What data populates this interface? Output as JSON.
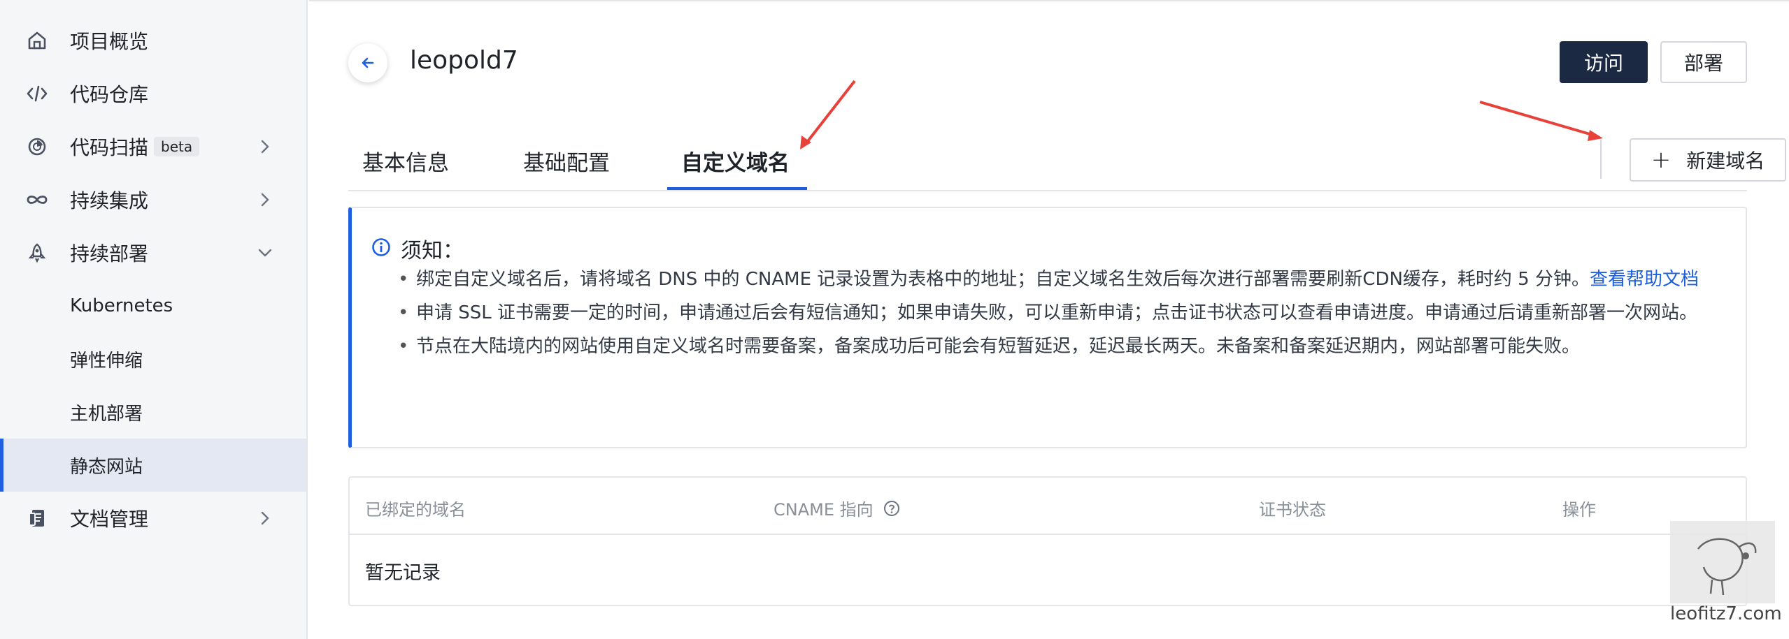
{
  "sidebar": {
    "items": [
      {
        "label": "项目概览",
        "icon": "home-icon"
      },
      {
        "label": "代码仓库",
        "icon": "code-icon"
      },
      {
        "label": "代码扫描",
        "icon": "scan-icon",
        "badge": "beta"
      },
      {
        "label": "持续集成",
        "icon": "infinity-icon"
      },
      {
        "label": "持续部署",
        "icon": "rocket-icon"
      },
      {
        "label": "Kubernetes"
      },
      {
        "label": "弹性伸缩"
      },
      {
        "label": "主机部署"
      },
      {
        "label": "静态网站",
        "active": true
      },
      {
        "label": "文档管理",
        "icon": "doc-icon"
      }
    ]
  },
  "header": {
    "title": "leopold7",
    "visit_label": "访问",
    "deploy_label": "部署"
  },
  "tabs": [
    {
      "label": "基本信息"
    },
    {
      "label": "基础配置"
    },
    {
      "label": "自定义域名",
      "active": true
    }
  ],
  "new_domain_label": "新建域名",
  "notice": {
    "title": "须知：",
    "item1_text": "绑定自定义域名后，请将域名 DNS 中的 CNAME 记录设置为表格中的地址；自定义域名生效后每次进行部署需要刷新CDN缓存，耗时约 5 分钟。",
    "item1_link": "查看帮助文档",
    "item2_text": "申请 SSL 证书需要一定的时间，申请通过后会有短信通知；如果申请失败，可以重新申请；点击证书状态可以查看申请进度。申请通过后请重新部署一次网站。",
    "item3_text": "节点在大陆境内的网站使用自定义域名时需要备案，备案成功后可能会有短暂延迟，延迟最长两天。未备案和备案延迟期内，网站部署可能失败。"
  },
  "table": {
    "columns": [
      "已绑定的域名",
      "CNAME 指向",
      "证书状态",
      "操作"
    ],
    "empty_text": "暂无记录"
  },
  "watermark": "leofitz7.com",
  "colors": {
    "accent": "#1e5fe0",
    "primary_button": "#1b2a42",
    "annotation_arrow": "#e8413a"
  }
}
